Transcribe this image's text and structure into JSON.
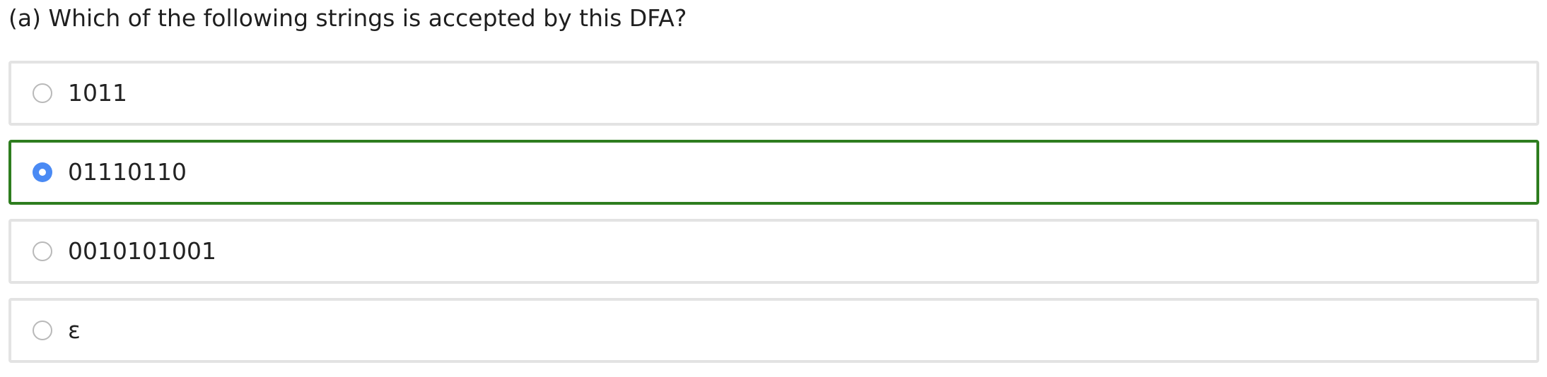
{
  "question": {
    "text": "(a) Which of the following strings is accepted by this DFA?"
  },
  "options": [
    {
      "label": "1011",
      "selected": false
    },
    {
      "label": "01110110",
      "selected": true
    },
    {
      "label": "0010101001",
      "selected": false
    },
    {
      "label": "ε",
      "selected": false
    }
  ],
  "colors": {
    "selected_border": "#2e7d1f",
    "radio_checked": "#4a8af4",
    "option_border": "#e3e3e3"
  }
}
